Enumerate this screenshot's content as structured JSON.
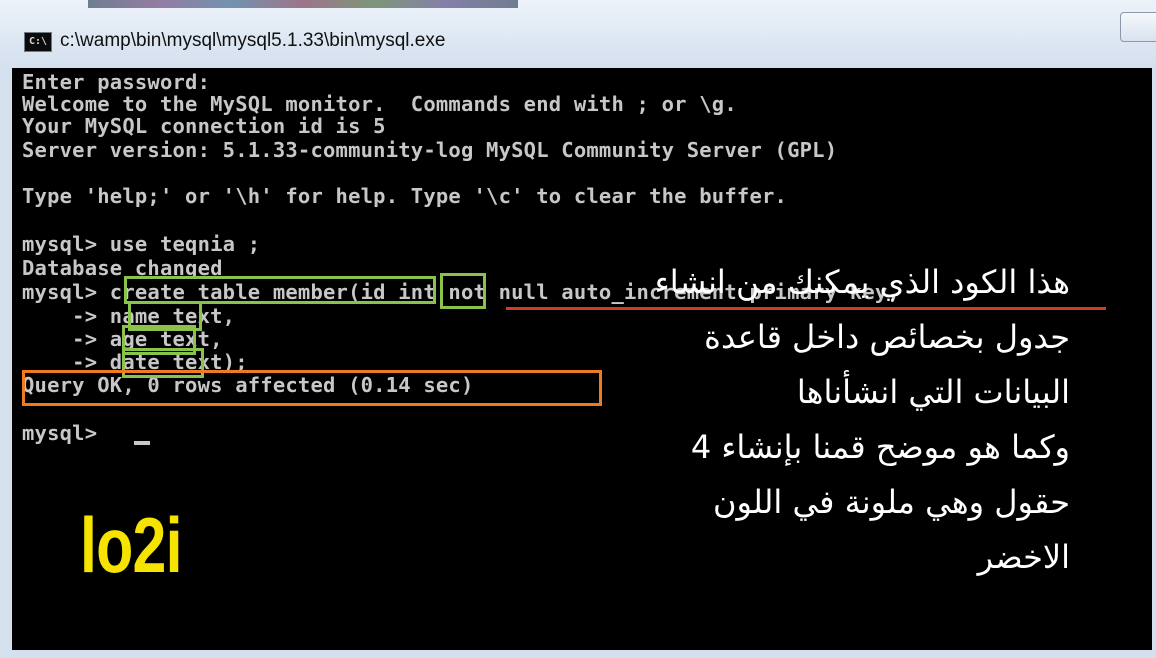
{
  "window": {
    "title": "c:\\wamp\\bin\\mysql\\mysql5.1.33\\bin\\mysql.exe",
    "icon": "cmd-icon"
  },
  "console": {
    "lines": [
      "Enter password:",
      "Welcome to the MySQL monitor.  Commands end with ; or \\g.",
      "Your MySQL connection id is 5",
      "Server version: 5.1.33-community-log MySQL Community Server (GPL)",
      "Type 'help;' or '\\h' for help. Type '\\c' to clear the buffer.",
      "mysql> use teqnia ;",
      "Database changed",
      "mysql> create table member(id int not null auto_increment primary key,",
      "    -> name text,",
      "    -> age text,",
      "    -> date text);",
      "Query OK, 0 rows affected (0.14 sec)",
      "mysql> "
    ]
  },
  "annotation": {
    "arabic_lines": [
      "هذا الكود الذي يمكنك من انشاء",
      "جدول بخصائص داخل قاعدة",
      "البيانات التي انشأناها",
      "وكما هو موضح قمنا بإنشاء 4",
      "حقول وهي ملونة في اللون",
      "الاخضر"
    ],
    "logo": "lo2i"
  },
  "colors": {
    "console_bg": "#000000",
    "console_text": "#c7c7c7",
    "highlight_green": "#8bc34a",
    "highlight_orange": "#f07b1f",
    "underline_red": "#d13b2e",
    "logo_yellow": "#f6e400"
  }
}
